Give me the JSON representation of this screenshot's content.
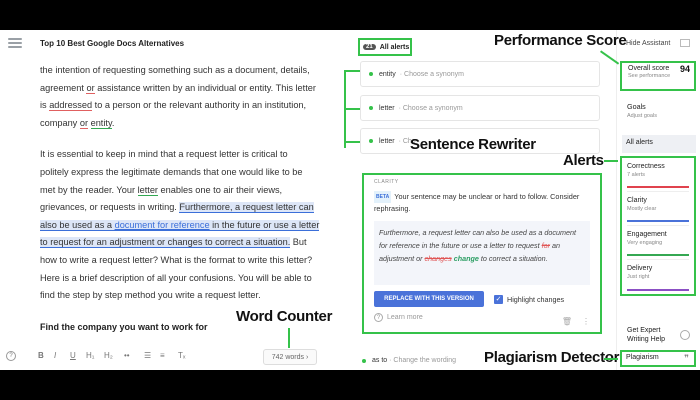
{
  "doc": {
    "title": "Top 10 Best Google Docs Alternatives",
    "p1_a": "the intention of requesting something such as a document, details,",
    "p1_b1": "agreement ",
    "p1_or1": "or",
    "p1_b2": " assistance written by an individual or entity. This letter",
    "p1_c1": "is ",
    "p1_addressed": "addressed",
    "p1_c2": " to a person or the relevant authority in an institution,",
    "p1_d1": "company ",
    "p1_or2": "or",
    "p1_d2": " ",
    "p1_entity": "entity",
    "p1_d3": ".",
    "p2_a": "It is essential to keep in mind that a request letter is critical to",
    "p2_b": "politely express the legitimate demands that one would like to be",
    "p2_c1": "met by the reader. Your ",
    "p2_letter": "letter",
    "p2_c2": " enables one to air their views,",
    "p2_d1": "grievances, or requests in writing.  ",
    "p2_hl1": "Furthermore, a request letter can",
    "p2_hl2a": "also be used as a ",
    "p2_link": "document for reference",
    "p2_hl2b": " in the future or use a letter",
    "p2_hl3": "to request for an adjustment or changes to correct a situation.",
    "p2_e": " But",
    "p2_f": "how to write a request letter? What is the format to write this letter?",
    "p2_g": "Here is a brief description of all your confusions. You will be able to",
    "p2_h": "find the step by step method you write a request letter.",
    "heading": "Find the company you want to work for"
  },
  "toolbar": {
    "help": "?",
    "bold": "B",
    "italic": "I",
    "underline": "U",
    "h1": "H₁",
    "h2": "H₂",
    "link": "••",
    "ol": "☰",
    "ul": "≡",
    "clear": "Tₓ",
    "word_count": "742 words",
    "word_count_arrow": "›"
  },
  "alerts": {
    "tab_count": "21",
    "tab_label": "All alerts",
    "items": [
      {
        "word": "entity",
        "suggestion": "· Choose a synonym"
      },
      {
        "word": "letter",
        "suggestion": "· Choose a synonym"
      },
      {
        "word": "letter",
        "suggestion": "· Cho"
      }
    ],
    "last": {
      "word": "as to",
      "suggestion": "· Change the wording"
    }
  },
  "rewriter": {
    "tag": "CLARITY",
    "beta": "BETA",
    "message": "Your sentence may be unclear or hard to follow. Consider rephrasing.",
    "s1": "Furthermore, a request letter can also be used as a document for reference in the future or use a letter to request ",
    "del1": "for",
    "s2": " an adjustment or ",
    "del2": "changes",
    "s3": " ",
    "ins1": "change",
    "s4": " to correct a situation.",
    "replace_label": "REPLACE WITH THIS VERSION",
    "highlight_label": "Highlight changes",
    "learn_more": "Learn more"
  },
  "panel": {
    "hide_assistant": "Hide Assistant",
    "overall_label": "Overall score",
    "overall_score": "94",
    "see_performance": "See performance",
    "goals_label": "Goals",
    "goals_sub": "Adjust goals",
    "all_alerts": "All alerts",
    "categories": [
      {
        "name": "Correctness",
        "sub": "7 alerts",
        "color": "#e0434e",
        "level": 1.0
      },
      {
        "name": "Clarity",
        "sub": "Mostly clear",
        "color": "#4a72d9",
        "level": 1.0
      },
      {
        "name": "Engagement",
        "sub": "Very engaging",
        "color": "#35a852",
        "level": 1.0
      },
      {
        "name": "Delivery",
        "sub": "Just right",
        "color": "#8b4fc4",
        "level": 1.0
      }
    ],
    "expert_line1": "Get Expert",
    "expert_line2": "Writing Help",
    "plagiarism": "Plagiarism"
  },
  "annotations": {
    "performance": "Performance Score",
    "rewriter": "Sentence Rewriter",
    "alerts": "Alerts",
    "word_counter": "Word Counter",
    "plagiarism": "Plagiarism Detector"
  },
  "colors": {
    "highlight_green": "#35c24a",
    "accent_blue": "#4a72d9"
  }
}
